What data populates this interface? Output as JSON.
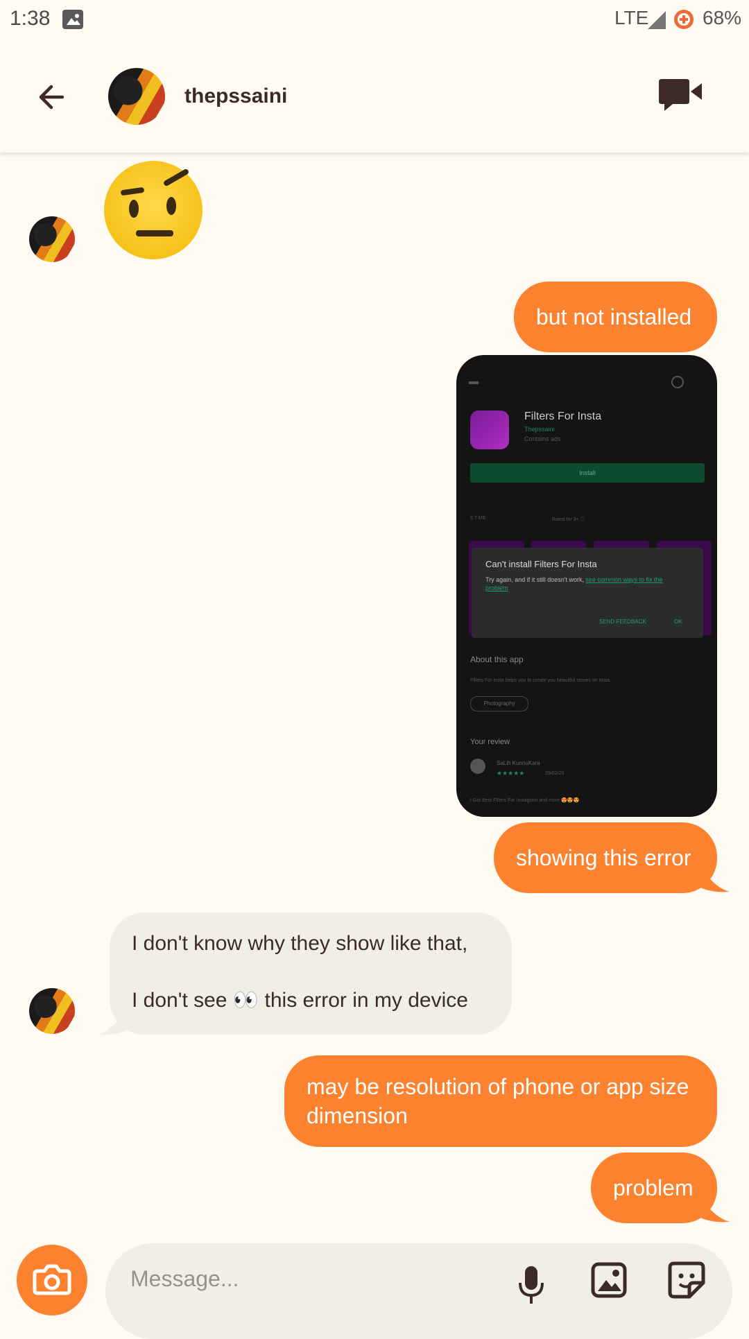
{
  "status_bar": {
    "time": "1:38",
    "network": "LTE",
    "battery": "68%"
  },
  "header": {
    "contact_name": "thepssaini"
  },
  "messages": {
    "sent_1": "but not installed",
    "sent_2": "showing this error",
    "received_line_1": "I don't know why they show like that,",
    "received_line_2": "I don't see 👀 this error in my device",
    "sent_3": "may be resolution of phone or app size dimension",
    "sent_4": "problem"
  },
  "screenshot": {
    "app_name": "Filters For Insta",
    "developer": "Thepssaini",
    "contains_ads": "Contains ads",
    "install": "Install",
    "size": "6.7 MB",
    "rated": "Rated for 3+ ⓘ",
    "dialog_title": "Can't install Filters For Insta",
    "dialog_body": "Try again, and if it still doesn't work,",
    "dialog_link": "see common ways to fix the problem",
    "send_feedback": "SEND FEEDBACK",
    "ok": "OK",
    "about_title": "About this app",
    "about_text": "Filters For Insta helps you to create you beautiful stories on Insta.",
    "category": "Photography",
    "your_review": "Your review",
    "reviewer": "SaLih KunnuKara",
    "review_date": "29/02/20",
    "review_text": "I Got Best Filters For Instagram and more 😍😍😍"
  },
  "composer": {
    "placeholder": "Message..."
  },
  "colors": {
    "accent": "#fd8230",
    "background": "#fffbf2",
    "incoming": "#f1eee6"
  }
}
